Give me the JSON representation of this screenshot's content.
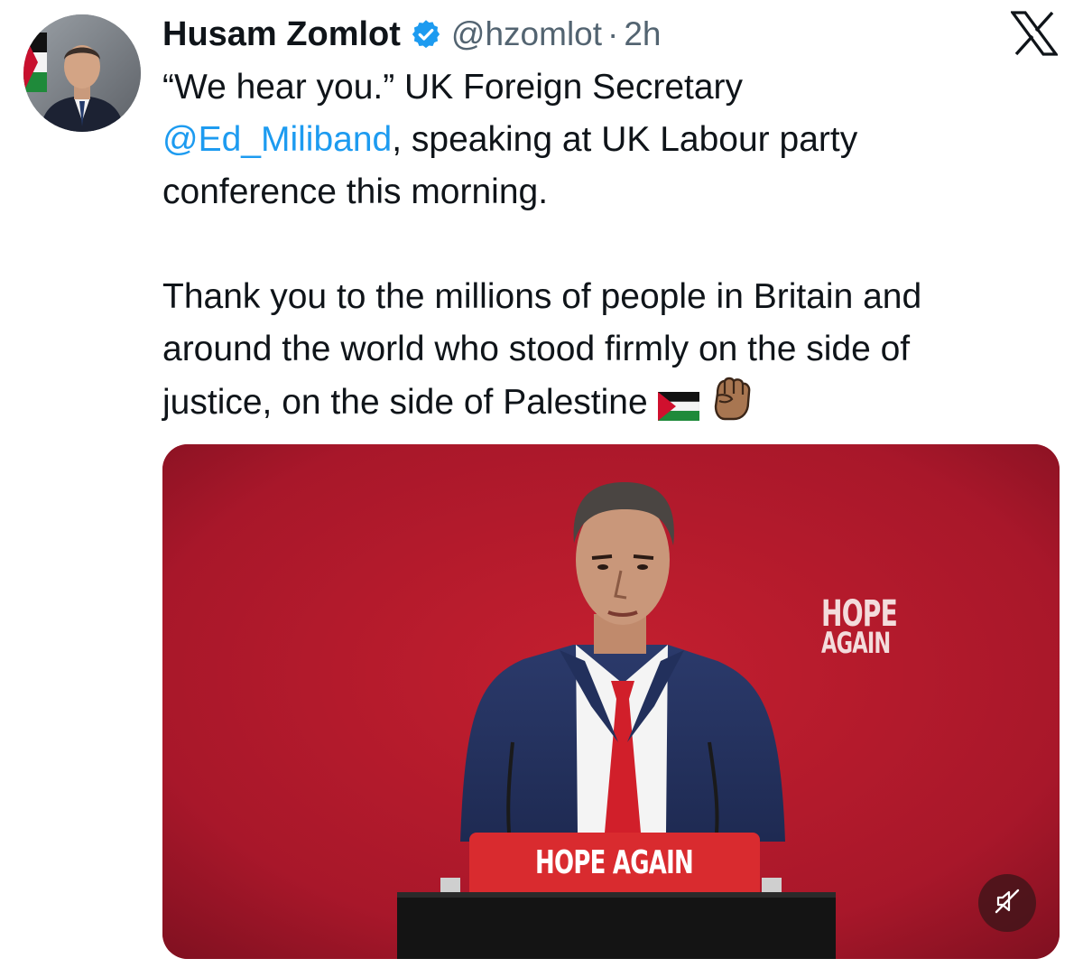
{
  "author": {
    "display_name": "Husam Zomlot",
    "verified_icon": "verified-badge-icon",
    "handle": "@hzomlot",
    "separator": "·",
    "time": "2h"
  },
  "tweet": {
    "text_part1": "“We hear you.” UK Foreign Secretary\n",
    "mention": "@Ed_Miliband",
    "text_part2": ", speaking at UK Labour party\nconference this morning.\n\nThank you to the millions of people in Britain and\naround the world who stood firmly on the side of\njustice, on the side of Palestine ",
    "emojis": [
      "palestine-flag-icon",
      "raised-fist-icon"
    ]
  },
  "media": {
    "background_sign_line1": "HOPE",
    "background_sign_line2": "AGAIN",
    "podium_sign": "HOPE AGAIN",
    "mute_icon": "speaker-muted-icon"
  },
  "platform": {
    "logo_icon": "x-logo-icon"
  },
  "colors": {
    "link": "#1d9bf0",
    "verified": "#1d9bf0",
    "stage_red": "#b3192a",
    "secondary_text": "#536471"
  }
}
